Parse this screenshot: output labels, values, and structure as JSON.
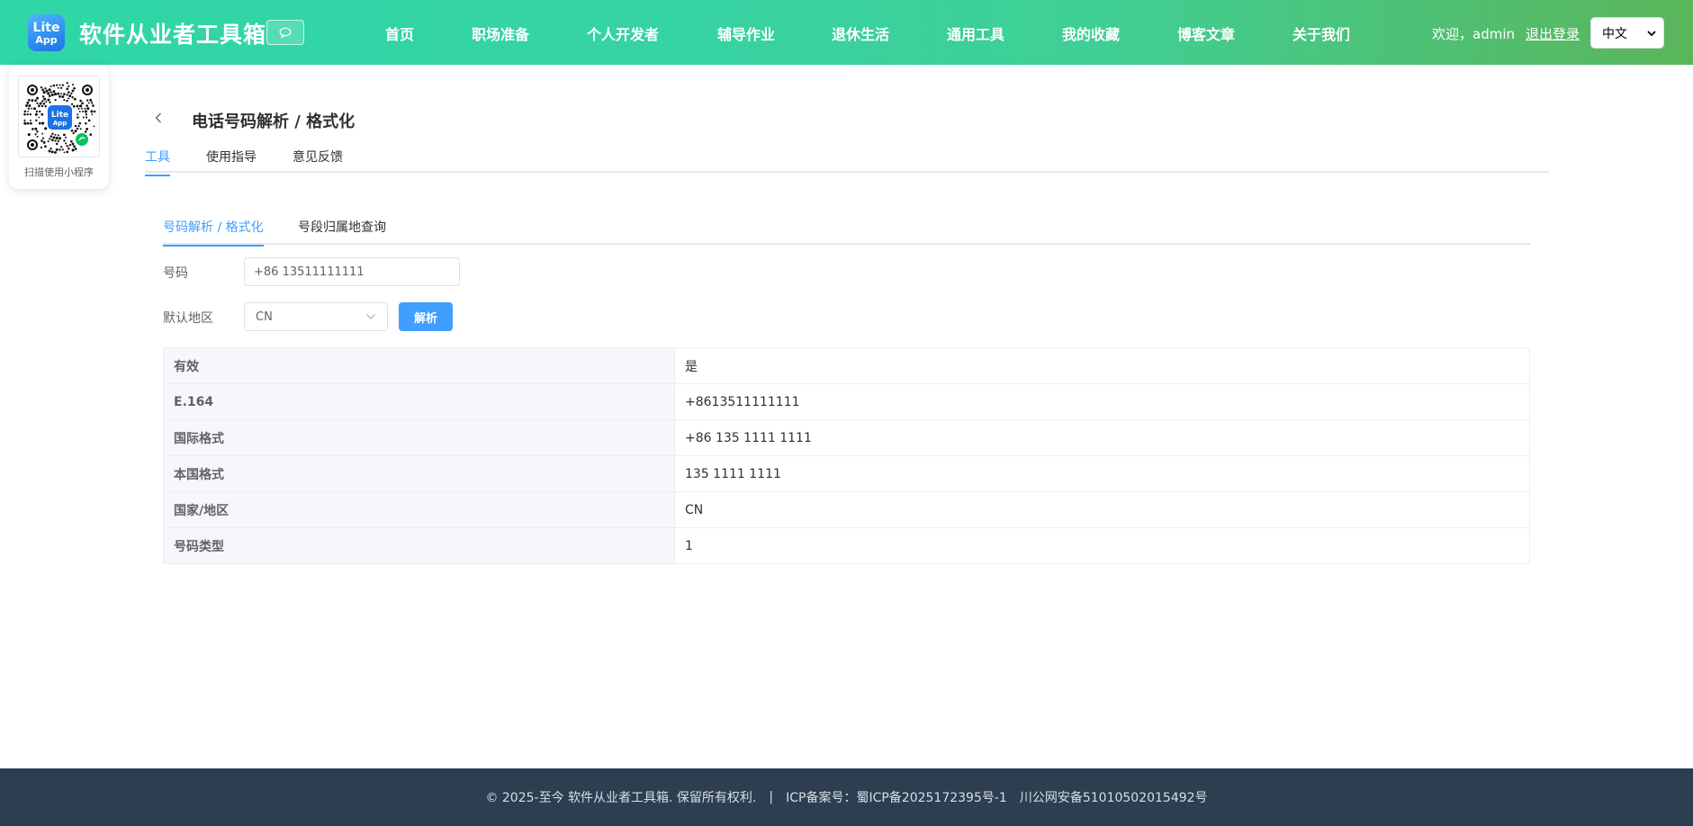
{
  "header": {
    "logo_line1": "Lite",
    "logo_line2": "App",
    "site_title": "软件从业者工具箱",
    "chat_icon": "chat-bubble-icon",
    "nav": [
      {
        "label": "首页"
      },
      {
        "label": "职场准备"
      },
      {
        "label": "个人开发者"
      },
      {
        "label": "辅导作业"
      },
      {
        "label": "退休生活"
      },
      {
        "label": "通用工具"
      },
      {
        "label": "我的收藏"
      },
      {
        "label": "博客文章"
      },
      {
        "label": "关于我们"
      }
    ],
    "welcome_text": "欢迎，admin",
    "logout_label": "退出登录",
    "language": "中文"
  },
  "qr": {
    "caption": "扫描使用小程序",
    "logo_line1": "Lite",
    "logo_line2": "App"
  },
  "page": {
    "title": "电话号码解析 / 格式化",
    "tabs": [
      {
        "label": "工具",
        "active": true
      },
      {
        "label": "使用指导",
        "active": false
      },
      {
        "label": "意见反馈",
        "active": false
      }
    ]
  },
  "tool": {
    "tabs": [
      {
        "label": "号码解析 / 格式化",
        "active": true
      },
      {
        "label": "号段归属地查询",
        "active": false
      }
    ],
    "number_label": "号码",
    "number_value": "+86 13511111111",
    "region_label": "默认地区",
    "region_value": "CN",
    "parse_button": "解析",
    "results": [
      {
        "key": "有效",
        "value": "是"
      },
      {
        "key": "E.164",
        "value": "+8613511111111"
      },
      {
        "key": "国际格式",
        "value": "+86 135 1111 1111"
      },
      {
        "key": "本国格式",
        "value": "135 1111 1111"
      },
      {
        "key": "国家/地区",
        "value": "CN"
      },
      {
        "key": "号码类型",
        "value": "1"
      }
    ]
  },
  "footer": {
    "copyright": "© 2025-至今 软件从业者工具箱. 保留所有权利.",
    "separator": "|",
    "icp": "ICP备案号：蜀ICP备2025172395号-1",
    "police": "川公网安备51010502015492号"
  },
  "colors": {
    "header_gradient_start": "#2fd6a7",
    "header_gradient_end": "#5bb55a",
    "accent": "#409eff",
    "footer_bg": "#2d3e50"
  }
}
